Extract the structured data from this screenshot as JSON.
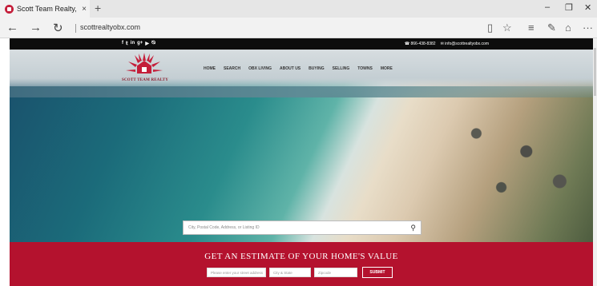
{
  "browser": {
    "tab_title": "Scott Team Realty, Inc. -",
    "tab_close": "×",
    "new_tab": "+",
    "url": "scottrealtyobx.com",
    "window_controls": {
      "minimize": "–",
      "restore": "❐",
      "close": "✕"
    },
    "nav": {
      "back": "←",
      "forward": "→",
      "refresh": "↻"
    },
    "toolbar_icons": [
      "reading-view-icon",
      "favorite-star-icon",
      "hub-icon",
      "web-note-icon",
      "share-icon",
      "more-icon"
    ],
    "toolbar_glyphs": {
      "reading": "▯",
      "star": "☆",
      "hub": "≡",
      "note": "✎",
      "share": "⌂",
      "more": "···"
    }
  },
  "site": {
    "top_bar": {
      "social_icons": {
        "facebook": "f",
        "twitter": "𝕥",
        "linkedin": "in",
        "googleplus": "g+",
        "youtube": "▶",
        "rss": "⦰"
      },
      "phone": "☎ 866-438-8382",
      "email": "✉ info@scottrealtyobx.com"
    },
    "logo_text": "SCOTT TEAM REALTY",
    "menu": [
      "HOME",
      "SEARCH",
      "OBX LIVING",
      "ABOUT US",
      "BUYING",
      "SELLING",
      "TOWNS",
      "MORE"
    ],
    "search": {
      "placeholder": "City, Postal Code, Address, or Listing ID",
      "icon": "⚲"
    },
    "estimate": {
      "heading": "GET AN ESTIMATE OF YOUR HOME'S VALUE",
      "address_placeholder": "Please enter your street address",
      "city_placeholder": "City & State",
      "zip_placeholder": "Zipcode",
      "submit_label": "SUBMIT"
    }
  },
  "colors": {
    "brand_red": "#b4122e",
    "logo_red": "#c41e3a",
    "top_bar": "#0d0d0d"
  }
}
